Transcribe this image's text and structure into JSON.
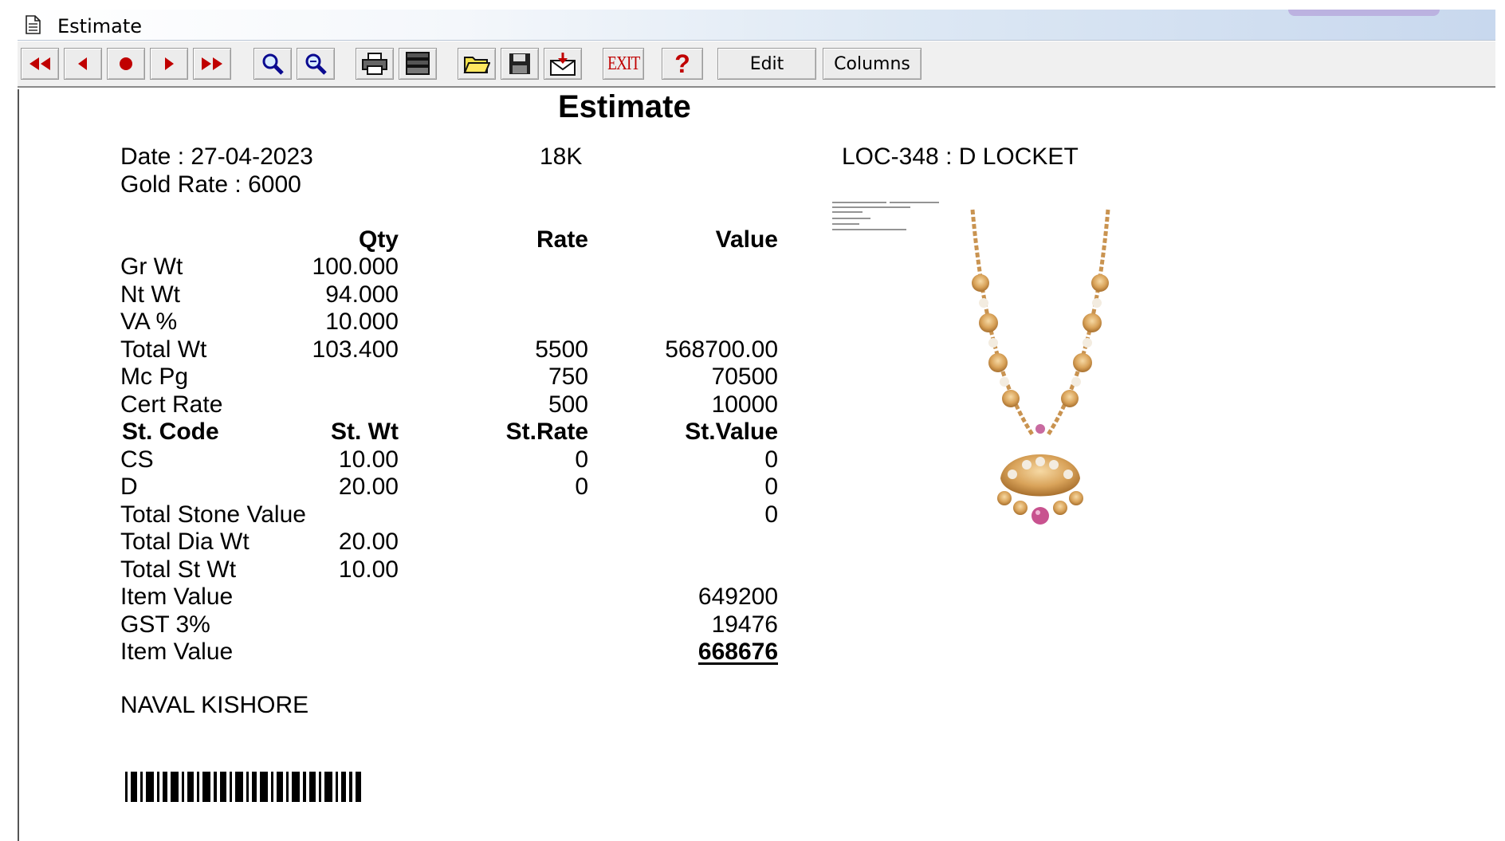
{
  "window": {
    "title": "Estimate",
    "icon": "document-icon"
  },
  "toolbar": {
    "buttons": [
      {
        "name": "first-record-button",
        "icon": "double-left-arrow-icon"
      },
      {
        "name": "previous-record-button",
        "icon": "left-arrow-icon"
      },
      {
        "name": "stop-button",
        "icon": "dot-icon"
      },
      {
        "name": "next-record-button",
        "icon": "right-arrow-icon"
      },
      {
        "name": "last-record-button",
        "icon": "double-right-arrow-icon"
      },
      {
        "name": "zoom-in-button",
        "icon": "magnifier-plus-icon"
      },
      {
        "name": "zoom-out-button",
        "icon": "magnifier-minus-icon"
      },
      {
        "name": "print-button",
        "icon": "printer-icon"
      },
      {
        "name": "print-setup-button",
        "icon": "printer-stack-icon"
      },
      {
        "name": "open-button",
        "icon": "folder-icon"
      },
      {
        "name": "save-button",
        "icon": "floppy-icon"
      },
      {
        "name": "export-button",
        "icon": "envelope-export-icon"
      },
      {
        "name": "exit-button",
        "icon": "exit-icon"
      },
      {
        "name": "help-button",
        "icon": "question-icon"
      }
    ],
    "exit_label": "EXIT",
    "help_label": "?",
    "edit_label": "Edit",
    "columns_label": "Columns"
  },
  "report": {
    "title": "Estimate",
    "date": "Date : 27-04-2023",
    "purity": "18K",
    "gold_rate": "Gold Rate : 6000",
    "item_code": "LOC-348 : D LOCKET",
    "headers": {
      "qty": "Qty",
      "rate": "Rate",
      "value": "Value"
    },
    "rows": [
      {
        "label": "Gr Wt",
        "qty": "100.000",
        "rate": "",
        "value": ""
      },
      {
        "label": "Nt Wt",
        "qty": "94.000",
        "rate": "",
        "value": ""
      },
      {
        "label": "VA %",
        "qty": "10.000",
        "rate": "",
        "value": ""
      },
      {
        "label": "Total Wt",
        "qty": "103.400",
        "rate": "5500",
        "value": "568700.00"
      },
      {
        "label": "Mc Pg",
        "qty": "",
        "rate": "750",
        "value": "70500"
      },
      {
        "label": "Cert Rate",
        "qty": "",
        "rate": "500",
        "value": "10000"
      }
    ],
    "stone_headers": {
      "code": "St. Code",
      "wt": "St. Wt",
      "rate": "St.Rate",
      "value": "St.Value"
    },
    "stones": [
      {
        "code": "CS",
        "wt": "10.00",
        "rate": "0",
        "value": "0"
      },
      {
        "code": "D",
        "wt": "20.00",
        "rate": "0",
        "value": "0"
      }
    ],
    "totals": [
      {
        "label": "Total Stone Value",
        "qty": "",
        "value": "0"
      },
      {
        "label": "Total Dia Wt",
        "qty": "20.00",
        "value": ""
      },
      {
        "label": "Total St Wt",
        "qty": "10.00",
        "value": ""
      },
      {
        "label": "Item Value",
        "qty": "",
        "value": "649200"
      },
      {
        "label": "GST 3%",
        "qty": "",
        "value": "19476"
      },
      {
        "label": "Item Value",
        "qty": "",
        "value": "668676"
      }
    ],
    "customer": "NAVAL KISHORE",
    "image_icon": "necklace-image",
    "barcode_icon": "barcode-icon"
  }
}
